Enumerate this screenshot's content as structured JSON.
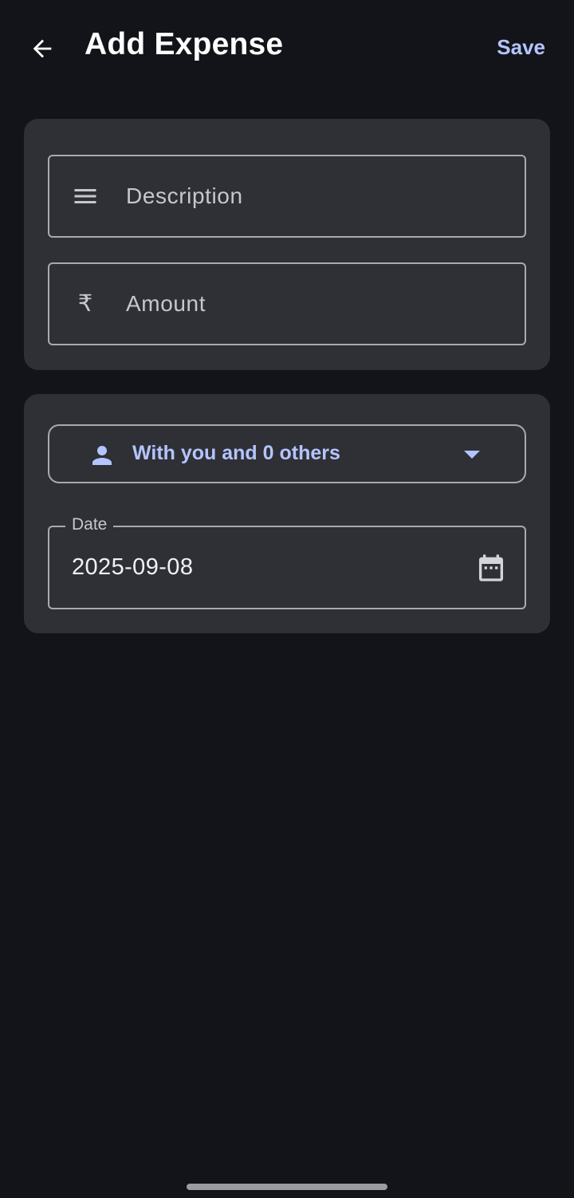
{
  "app_bar": {
    "title": "Add Expense",
    "save_label": "Save",
    "back_icon": "arrow-back-icon"
  },
  "form": {
    "description": {
      "placeholder": "Description",
      "value": "",
      "icon": "notes-icon"
    },
    "amount": {
      "placeholder": "Amount",
      "value": "",
      "currency_symbol": "₹",
      "icon": "rupee-icon"
    },
    "split": {
      "label": "With you and 0 others",
      "icon": "person-icon"
    },
    "date": {
      "label": "Date",
      "value": "2025-09-08",
      "icon": "calendar-icon"
    }
  },
  "colors": {
    "background": "#131419",
    "card": "#2f3036",
    "accent": "#b4c4ff",
    "outline": "#a9a9b1"
  }
}
